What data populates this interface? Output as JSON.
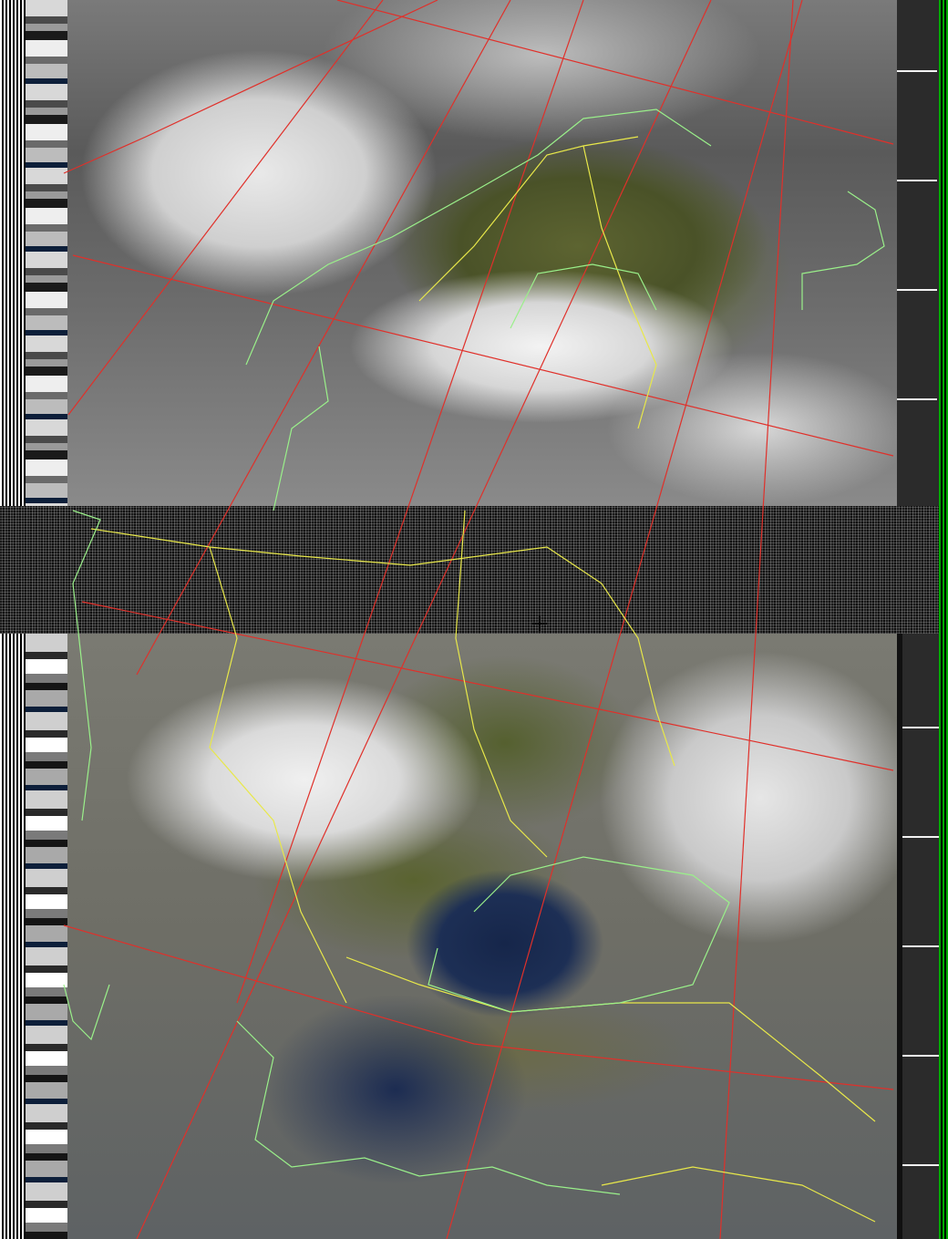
{
  "image": {
    "description_type": "satellite",
    "colors": {
      "grid": "#e0302a",
      "borders": "#e8e84a",
      "coastlines": "#9af08a",
      "sea": "#1d2f55",
      "cloud": "#e6e6e6",
      "land": "#55602f",
      "sync_green": "#00aa00"
    }
  }
}
